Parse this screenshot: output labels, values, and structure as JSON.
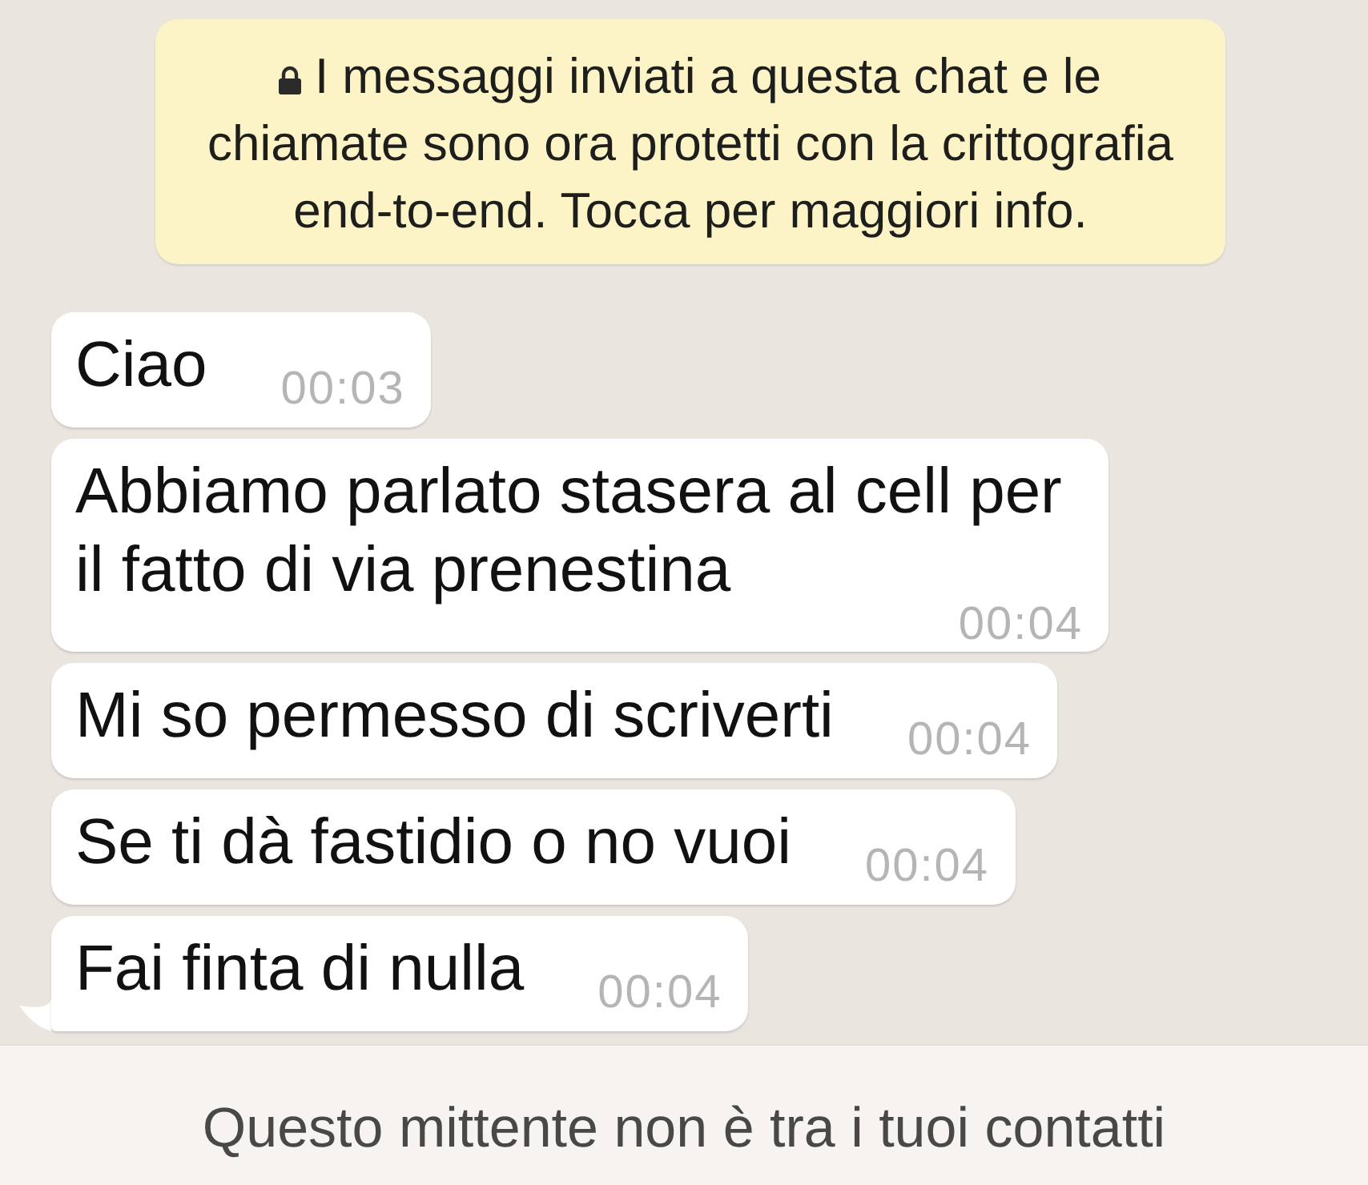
{
  "encryption_notice": {
    "text": "I messaggi inviati a questa chat e le chiamate sono ora protetti con la crittografia end-to-end. Tocca per maggiori info."
  },
  "messages": [
    {
      "text": "Ciao",
      "time": "00:03",
      "tail": false
    },
    {
      "text": "Abbiamo parlato stasera al cell per il fatto di via prenestina",
      "time": "00:04",
      "tail": false
    },
    {
      "text": "Mi so permesso di scriverti",
      "time": "00:04",
      "tail": false
    },
    {
      "text": "Se ti dà fastidio o no vuoi",
      "time": "00:04",
      "tail": false
    },
    {
      "text": "Fai finta di nulla",
      "time": "00:04",
      "tail": true
    }
  ],
  "footer": {
    "text": "Questo mittente non è tra i tuoi contatti"
  }
}
